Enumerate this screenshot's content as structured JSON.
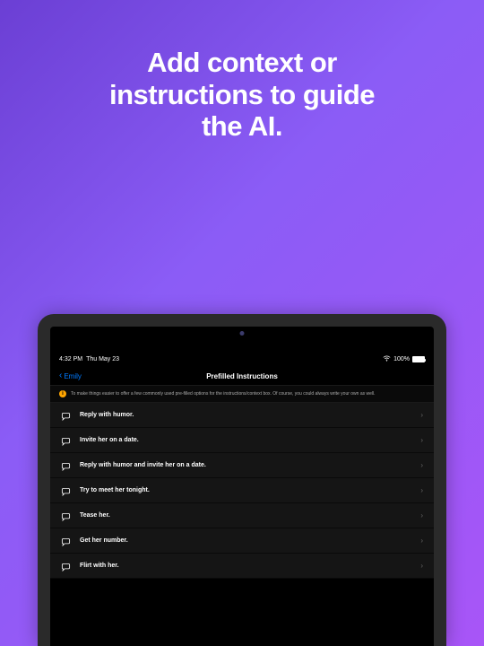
{
  "hero": {
    "line1": "Add context or",
    "line2": "instructions to guide",
    "line3": "the AI."
  },
  "status_bar": {
    "time": "4:32 PM",
    "date": "Thu May 23",
    "battery_pct": "100%"
  },
  "nav": {
    "back_label": "Emily",
    "title": "Prefilled Instructions"
  },
  "info_banner": {
    "text": "To make things easier to offer a few commonly used pre-filled options for the instructions/context box. Of course, you could always write your own as well."
  },
  "instructions": [
    {
      "label": "Reply with humor."
    },
    {
      "label": "Invite her on a date."
    },
    {
      "label": "Reply with humor and invite her on a date."
    },
    {
      "label": "Try to meet her tonight."
    },
    {
      "label": "Tease her."
    },
    {
      "label": "Get her number."
    },
    {
      "label": "Flirt with her."
    }
  ]
}
